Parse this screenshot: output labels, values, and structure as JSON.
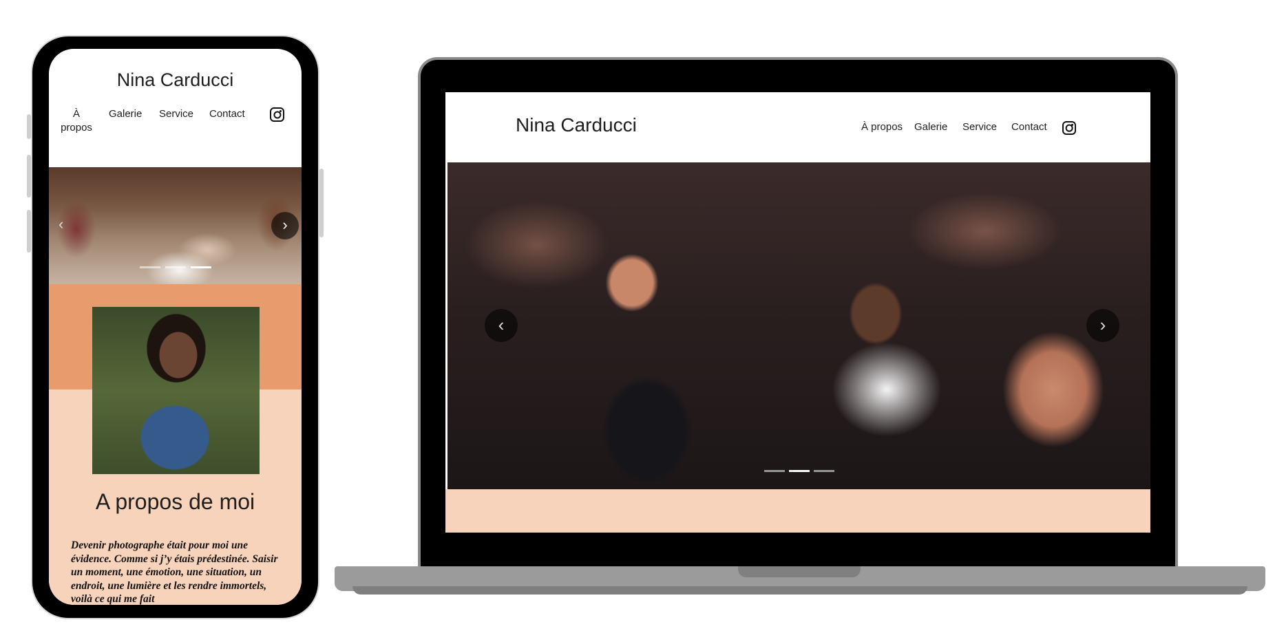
{
  "site": {
    "brand": "Nina Carducci",
    "nav": [
      "À propos",
      "Galerie",
      "Service",
      "Contact"
    ],
    "nav_mobile_first": [
      "À",
      "propos"
    ],
    "social_icon": "instagram-icon"
  },
  "carousel": {
    "prev_glyph": "‹",
    "next_glyph": "›",
    "slide_count": 3,
    "mobile_active_index": 2,
    "desktop_active_index": 1
  },
  "about": {
    "heading": "A propos de moi",
    "text": "Devenir photographe était pour moi une évidence. Comme si j’y étais prédestinée. Saisir un moment, une émotion, une situation, un endroit, une lumière et les rendre immortels, voilà ce qui me fait"
  },
  "colors": {
    "accent_orange": "#e89c6e",
    "accent_peach": "#f7d3bb",
    "text_dark": "#1e1e1e"
  }
}
